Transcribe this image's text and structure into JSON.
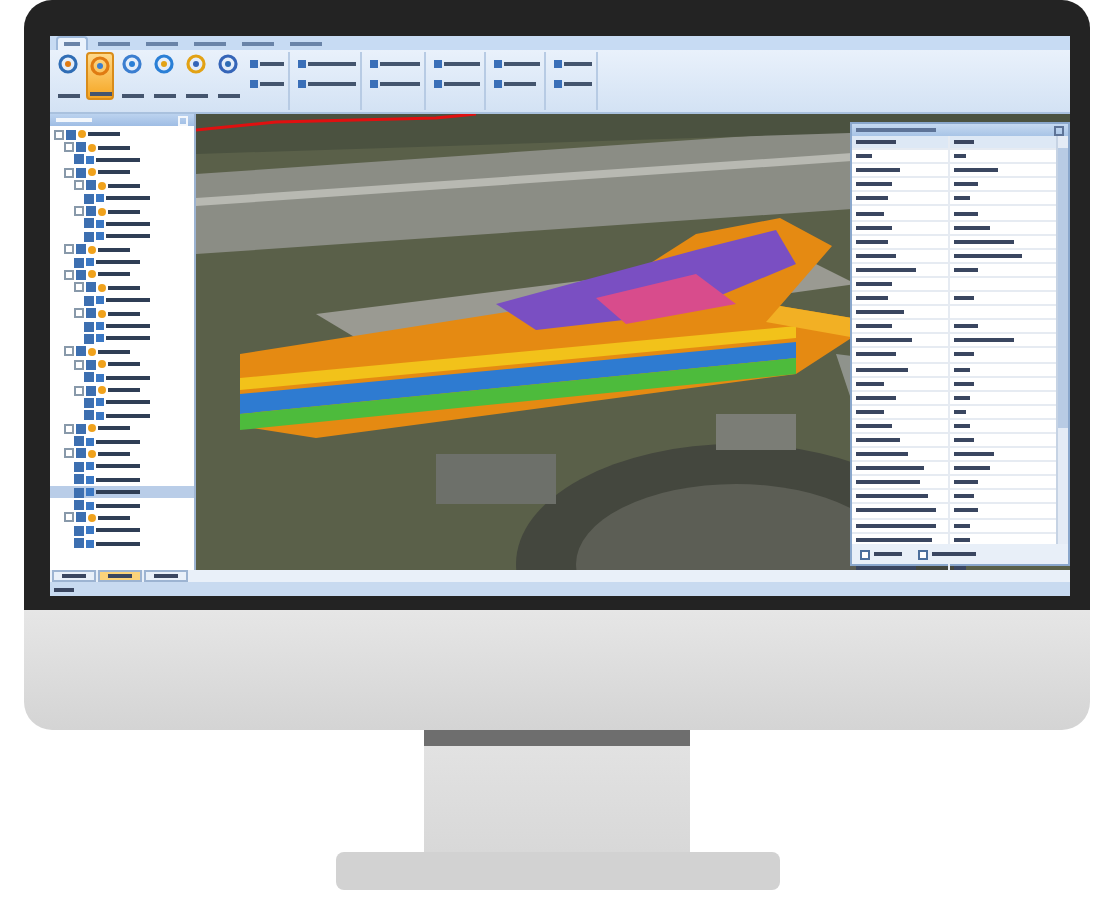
{
  "ribbon": {
    "tabs": [
      {
        "selected": true
      },
      {
        "selected": false
      },
      {
        "selected": false
      },
      {
        "selected": false
      },
      {
        "selected": false
      },
      {
        "selected": false
      }
    ],
    "large_buttons": [
      {
        "selected": false
      },
      {
        "selected": true
      },
      {
        "selected": false
      },
      {
        "selected": false
      },
      {
        "selected": false
      },
      {
        "selected": false
      }
    ]
  },
  "tree": {
    "items": [
      {
        "expanded": true,
        "checked": true,
        "selected": false,
        "children": [
          {
            "expanded": true,
            "checked": true,
            "selected": false,
            "children": [
              {
                "checked": true,
                "selected": false
              }
            ]
          },
          {
            "expanded": true,
            "checked": true,
            "selected": false,
            "children": [
              {
                "expanded": true,
                "checked": true,
                "selected": false,
                "children": [
                  {
                    "checked": true,
                    "selected": false
                  }
                ]
              },
              {
                "expanded": true,
                "checked": true,
                "selected": false,
                "children": [
                  {
                    "checked": true,
                    "selected": false
                  },
                  {
                    "checked": true,
                    "selected": false
                  }
                ]
              }
            ]
          },
          {
            "expanded": true,
            "checked": true,
            "selected": false,
            "children": [
              {
                "checked": true,
                "selected": false
              }
            ]
          },
          {
            "expanded": true,
            "checked": true,
            "selected": false,
            "children": [
              {
                "expanded": true,
                "checked": true,
                "selected": false,
                "children": [
                  {
                    "checked": true,
                    "selected": false
                  }
                ]
              },
              {
                "expanded": true,
                "checked": true,
                "selected": false,
                "children": [
                  {
                    "checked": true,
                    "selected": false
                  },
                  {
                    "checked": true,
                    "selected": false
                  }
                ]
              }
            ]
          },
          {
            "expanded": true,
            "checked": true,
            "selected": false,
            "children": [
              {
                "expanded": true,
                "checked": true,
                "selected": false,
                "children": [
                  {
                    "checked": true,
                    "selected": false
                  }
                ]
              },
              {
                "expanded": true,
                "checked": true,
                "selected": false,
                "children": [
                  {
                    "checked": true,
                    "selected": false
                  },
                  {
                    "checked": true,
                    "selected": false
                  }
                ]
              }
            ]
          },
          {
            "expanded": true,
            "checked": true,
            "selected": false,
            "children": [
              {
                "checked": true,
                "selected": false
              }
            ]
          },
          {
            "expanded": true,
            "checked": true,
            "selected": false,
            "children": [
              {
                "checked": true,
                "selected": false
              },
              {
                "checked": true,
                "selected": false
              },
              {
                "checked": true,
                "selected": true
              },
              {
                "checked": true,
                "selected": false
              }
            ]
          },
          {
            "expanded": true,
            "checked": true,
            "selected": false,
            "children": [
              {
                "checked": true,
                "selected": false
              },
              {
                "checked": true,
                "selected": false
              }
            ]
          }
        ]
      }
    ]
  },
  "panel_tabs": [
    {
      "selected": false
    },
    {
      "selected": true
    },
    {
      "selected": false
    }
  ],
  "properties": {
    "options": [
      {
        "checked": false
      },
      {
        "checked": false
      }
    ]
  }
}
